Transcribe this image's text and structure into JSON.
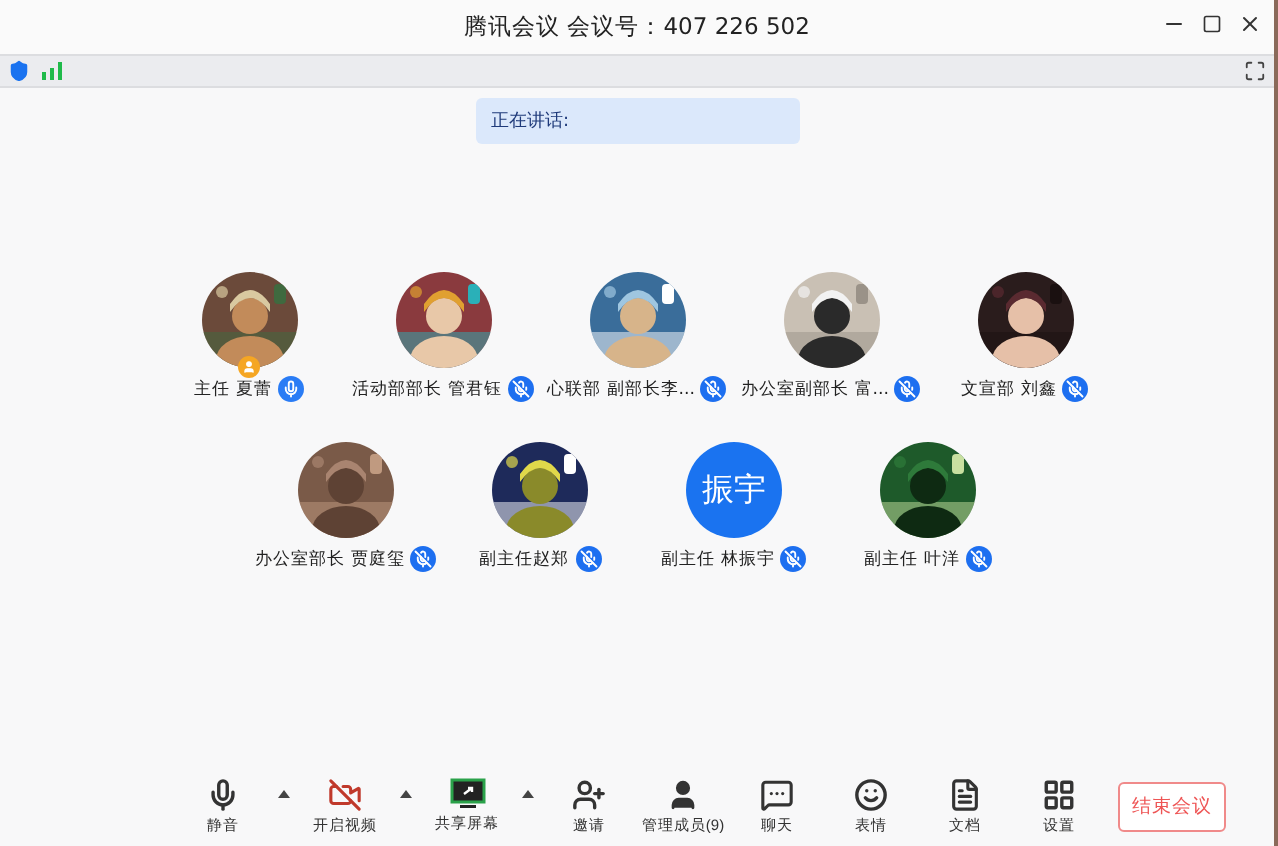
{
  "window": {
    "title": "腾讯会议 会议号：407 226 502"
  },
  "speaking": {
    "label": "正在讲话:"
  },
  "participants": [
    {
      "name": "主任 夏蕾",
      "muted": false,
      "host": true
    },
    {
      "name": "活动部部长 管君钰",
      "muted": true,
      "host": false
    },
    {
      "name": "心联部 副部长李...",
      "muted": true,
      "host": false
    },
    {
      "name": "办公室副部长 富...",
      "muted": true,
      "host": false
    },
    {
      "name": "文宣部 刘鑫",
      "muted": true,
      "host": false
    },
    {
      "name": "办公室部长 贾庭玺",
      "muted": true,
      "host": false
    },
    {
      "name": "副主任赵郑",
      "muted": true,
      "host": false
    },
    {
      "name": "副主任 林振宇",
      "muted": true,
      "host": false,
      "avatar": {
        "kind": "text",
        "text": "振宇"
      }
    },
    {
      "name": "副主任 叶洋",
      "muted": true,
      "host": false
    }
  ],
  "toolbar": [
    {
      "kind": "mic",
      "label": "静音"
    },
    {
      "kind": "caret"
    },
    {
      "kind": "video",
      "label": "开启视频"
    },
    {
      "kind": "caret"
    },
    {
      "kind": "share",
      "label": "共享屏幕"
    },
    {
      "kind": "caret"
    },
    {
      "kind": "invite",
      "label": "邀请"
    },
    {
      "kind": "members",
      "label": "管理成员(9)"
    },
    {
      "kind": "chat",
      "label": "聊天"
    },
    {
      "kind": "emoji",
      "label": "表情"
    },
    {
      "kind": "docs",
      "label": "文档"
    },
    {
      "kind": "settings",
      "label": "设置"
    }
  ],
  "end_button": "结束会议"
}
